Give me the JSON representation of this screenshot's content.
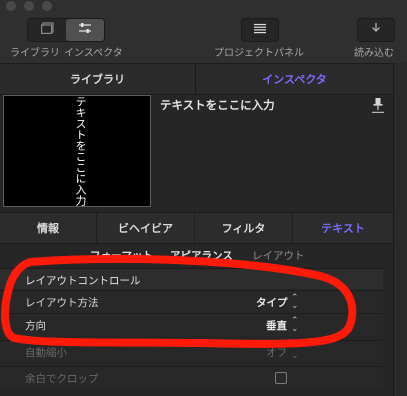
{
  "toolbar": {
    "library_label": "ライブラリ",
    "inspector_label": "インスペクタ",
    "project_panel_label": "プロジェクトパネル",
    "import_label": "読み込む",
    "library_icon": "library-icon",
    "inspector_icon": "sliders-icon",
    "project_panel_icon": "list-icon",
    "import_icon": "download-arrow-icon"
  },
  "main_tabs": [
    "ライブラリ",
    "インスペクタ"
  ],
  "preview": {
    "vertical_text": "テキストをここに入力",
    "title": "テキストをここに入力"
  },
  "sub_tabs": [
    "情報",
    "ビヘイビア",
    "フィルタ",
    "テキスト"
  ],
  "text_tabs": [
    "フォーマット",
    "アピアランス",
    "レイアウト"
  ],
  "layout_section": {
    "header": "レイアウトコントロール",
    "rows": [
      {
        "label": "レイアウト方法",
        "value": "タイプ"
      },
      {
        "label": "方向",
        "value": "垂直"
      },
      {
        "label": "自動縮小",
        "value": "オフ"
      },
      {
        "label": "余白でクロップ",
        "value": ""
      }
    ]
  },
  "colors": {
    "accent": "#7b6bff",
    "annotation": "#ff1a0a"
  }
}
